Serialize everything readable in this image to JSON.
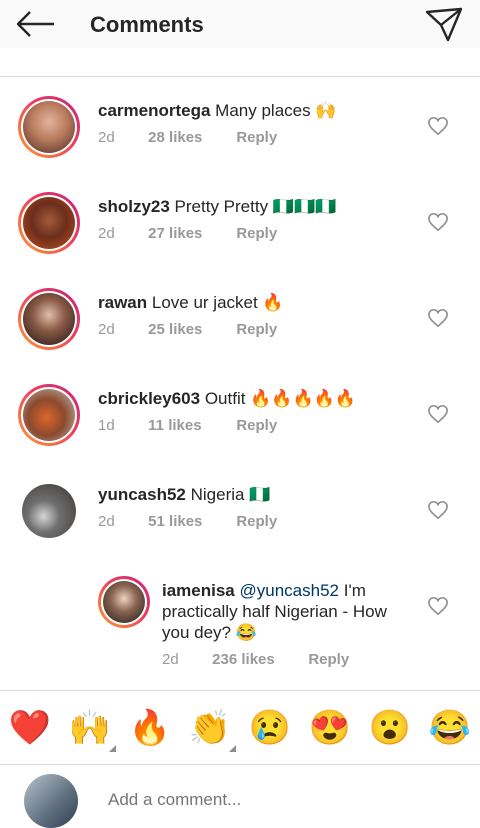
{
  "header": {
    "title": "Comments"
  },
  "comments": [
    {
      "user": "carmenortega",
      "text": "Many places 🙌",
      "age": "2d",
      "likes": "28 likes",
      "reply": "Reply"
    },
    {
      "user": "sholzy23",
      "text": "Pretty Pretty 🇳🇬🇳🇬🇳🇬",
      "age": "2d",
      "likes": "27 likes",
      "reply": "Reply"
    },
    {
      "user": "rawan",
      "text": "Love ur jacket 🔥",
      "age": "2d",
      "likes": "25 likes",
      "reply": "Reply"
    },
    {
      "user": "cbrickley603",
      "text": "Outfit 🔥🔥🔥🔥🔥",
      "age": "1d",
      "likes": "11 likes",
      "reply": "Reply"
    },
    {
      "user": "yuncash52",
      "text": "Nigeria 🇳🇬",
      "age": "2d",
      "likes": "51 likes",
      "reply": "Reply"
    }
  ],
  "reply": {
    "user": "iamenisa",
    "mention": "@yuncash52",
    "text": " I'm practically half Nigerian - How you dey? 😂",
    "age": "2d",
    "likes": "236 likes",
    "reply": "Reply"
  },
  "reactions": [
    "❤️",
    "🙌",
    "🔥",
    "👏",
    "😢",
    "😍",
    "😮",
    "😂"
  ],
  "input": {
    "placeholder": "Add a comment..."
  },
  "icons": {
    "back": "arrow-left-icon",
    "send": "paper-plane-icon",
    "like": "heart-outline-icon"
  },
  "colors": {
    "story_ring_start": "#f6a03a",
    "story_ring_end": "#c0267f",
    "meta_text": "#999999",
    "mention": "#003569"
  }
}
